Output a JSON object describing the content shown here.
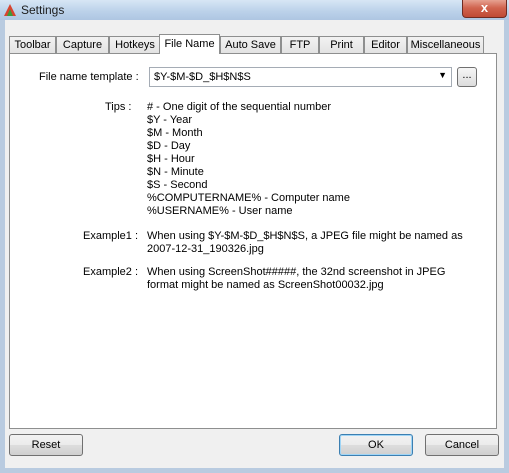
{
  "window": {
    "title": "Settings",
    "close_glyph": "x"
  },
  "tabs": [
    {
      "label": "Toolbar"
    },
    {
      "label": "Capture"
    },
    {
      "label": "Hotkeys"
    },
    {
      "label": "File Name"
    },
    {
      "label": "Auto Save"
    },
    {
      "label": "FTP"
    },
    {
      "label": "Print"
    },
    {
      "label": "Editor"
    },
    {
      "label": "Miscellaneous"
    }
  ],
  "active_tab": "File Name",
  "form": {
    "template_label": "File name template :",
    "template_value": "$Y-$M-$D_$H$N$S",
    "dropdown_glyph": "▼",
    "browse_label": "...",
    "tips_label": "Tips :",
    "tips": [
      "#  - One digit of the sequential number",
      "$Y -  Year",
      "$M -  Month",
      "$D -  Day",
      "$H -  Hour",
      "$N -  Minute",
      "$S -  Second",
      "%COMPUTERNAME% - Computer name",
      "%USERNAME% - User name"
    ],
    "example1_label": "Example1 :",
    "example1_text": "When using $Y-$M-$D_$H$N$S, a JPEG file might be named as",
    "example1_text2": "2007-12-31_190326.jpg",
    "example2_label": "Example2 :",
    "example2_text": "When using ScreenShot#####, the 32nd screenshot in JPEG",
    "example2_text2": "format might be named as ScreenShot00032.jpg"
  },
  "buttons": {
    "reset": "Reset",
    "ok": "OK",
    "cancel": "Cancel"
  },
  "colors": {
    "titlebar": "#bcd2ea",
    "close": "#c94f3a",
    "dialog": "#f0f0f0",
    "default_border": "#3c7fb1"
  }
}
